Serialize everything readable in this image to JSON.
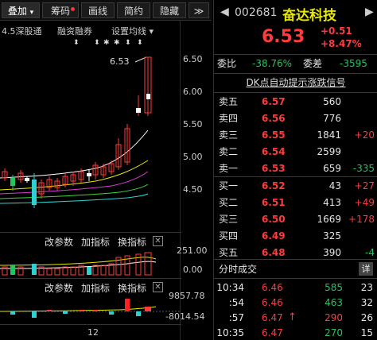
{
  "toolbar": {
    "tabs": [
      {
        "label": "叠加",
        "suffix": "▾"
      },
      {
        "label": "筹码"
      },
      {
        "label": "画线"
      },
      {
        "label": "简约"
      },
      {
        "label": "隐藏"
      }
    ],
    "nav": "≫"
  },
  "chart_header": {
    "index_label": "4.5深股通",
    "margin_label": "融资融券",
    "ma_label": "设置均线 ▾"
  },
  "price_axis": [
    "6.50",
    "6.00",
    "5.50",
    "5.00",
    "4.50"
  ],
  "high_label": "6.53",
  "volume_panel": {
    "buttons": [
      "改参数",
      "加指标",
      "换指标"
    ],
    "close": "✕",
    "axis": [
      "251.00",
      "0.00"
    ]
  },
  "indicator_panel": {
    "buttons": [
      "改参数",
      "加指标",
      "换指标"
    ],
    "close": "✕",
    "axis": [
      "9857.78",
      "-8014.54"
    ]
  },
  "date_axis_label": "12",
  "quote": {
    "code": "002681",
    "name": "奋达科技",
    "price": "6.53",
    "change": "+0.51",
    "change_pct": "+8.47%",
    "weibi_label": "委比",
    "weibi_value": "-38.76%",
    "weicha_label": "委差",
    "weicha_value": "-3595",
    "banner": "DK点自动提示涨跌信号"
  },
  "sell_orders": [
    {
      "label": "卖五",
      "price": "6.57",
      "volume": "560",
      "delta": ""
    },
    {
      "label": "卖四",
      "price": "6.56",
      "volume": "776",
      "delta": ""
    },
    {
      "label": "卖三",
      "price": "6.55",
      "volume": "1841",
      "delta": "+20"
    },
    {
      "label": "卖二",
      "price": "6.54",
      "volume": "2599",
      "delta": ""
    },
    {
      "label": "卖一",
      "price": "6.53",
      "volume": "659",
      "delta": "-335"
    }
  ],
  "buy_orders": [
    {
      "label": "买一",
      "price": "6.52",
      "volume": "43",
      "delta": "+27"
    },
    {
      "label": "买二",
      "price": "6.51",
      "volume": "413",
      "delta": "+49"
    },
    {
      "label": "买三",
      "price": "6.50",
      "volume": "1669",
      "delta": "+178"
    },
    {
      "label": "买四",
      "price": "6.49",
      "volume": "325",
      "delta": ""
    },
    {
      "label": "买五",
      "price": "6.48",
      "volume": "390",
      "delta": "-4"
    }
  ],
  "ticks_header": {
    "title": "分时成交",
    "detail": "详"
  },
  "ticks": [
    {
      "time": "10:34",
      "price": "6.46",
      "volume": "585",
      "count": "23",
      "arrow": ""
    },
    {
      "time": ":54",
      "price": "6.46",
      "volume": "463",
      "count": "32",
      "arrow": ""
    },
    {
      "time": ":57",
      "price": "6.47",
      "volume": "290",
      "count": "26",
      "arrow": "↑"
    },
    {
      "time": "10:35",
      "price": "6.47",
      "volume": "270",
      "count": "15",
      "arrow": ""
    }
  ],
  "colors": {
    "up": "#ff3b3b",
    "down": "#22c55e",
    "name": "#e8e800",
    "ma_yellow": "#e8e800",
    "ma_white": "#ffffff",
    "ma_magenta": "#d63cd6",
    "ma_green": "#3cd63c",
    "ma_cyan": "#2fd0d0"
  }
}
